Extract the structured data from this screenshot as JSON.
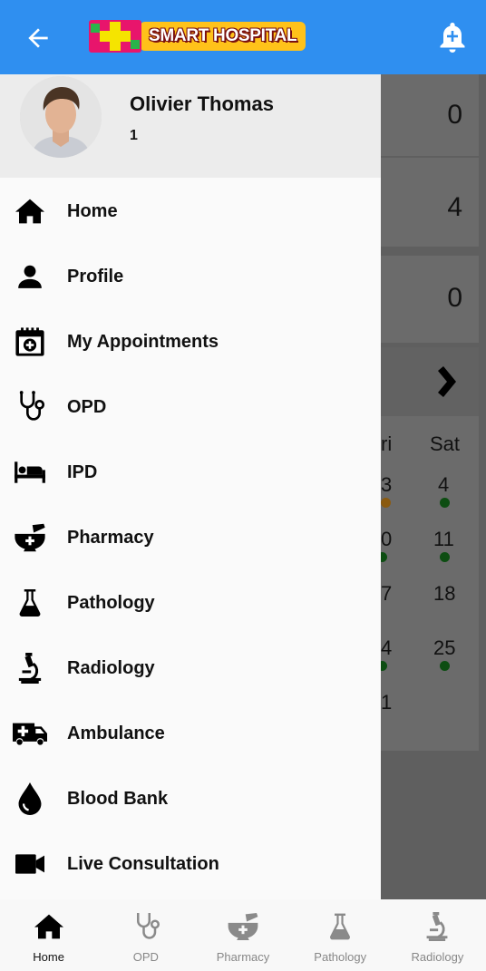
{
  "header": {
    "logo_text": "SMART HOSPITAL",
    "accent_color": "#2f8ff0",
    "icons": {
      "back": "arrow-left-icon",
      "notifications": "bell-plus-icon"
    }
  },
  "user": {
    "name": "Olivier Thomas",
    "id": "1"
  },
  "menu": [
    {
      "label": "Home",
      "icon": "home-icon"
    },
    {
      "label": "Profile",
      "icon": "person-icon"
    },
    {
      "label": "My Appointments",
      "icon": "calendar-plus-icon"
    },
    {
      "label": "OPD",
      "icon": "stethoscope-icon"
    },
    {
      "label": "IPD",
      "icon": "bed-icon"
    },
    {
      "label": "Pharmacy",
      "icon": "mortar-pestle-icon"
    },
    {
      "label": "Pathology",
      "icon": "flask-icon"
    },
    {
      "label": "Radiology",
      "icon": "microscope-icon"
    },
    {
      "label": "Ambulance",
      "icon": "ambulance-icon"
    },
    {
      "label": "Blood Bank",
      "icon": "blood-drop-icon"
    },
    {
      "label": "Live Consultation",
      "icon": "video-camera-icon"
    }
  ],
  "background": {
    "counts": [
      "0",
      "4",
      "0"
    ],
    "calendar": {
      "day_headers": [
        "ri",
        "Sat"
      ],
      "row1": [
        "3",
        "4"
      ],
      "row2": [
        "0",
        "11"
      ],
      "row3": [
        "7",
        "18"
      ],
      "row4": [
        "4",
        "25"
      ],
      "row5": [
        "1"
      ]
    }
  },
  "bottom_nav": [
    {
      "label": "Home",
      "icon": "home-icon",
      "active": true
    },
    {
      "label": "OPD",
      "icon": "stethoscope-icon",
      "active": false
    },
    {
      "label": "Pharmacy",
      "icon": "mortar-pestle-icon",
      "active": false
    },
    {
      "label": "Pathology",
      "icon": "flask-icon",
      "active": false
    },
    {
      "label": "Radiology",
      "icon": "microscope-icon",
      "active": false
    }
  ]
}
